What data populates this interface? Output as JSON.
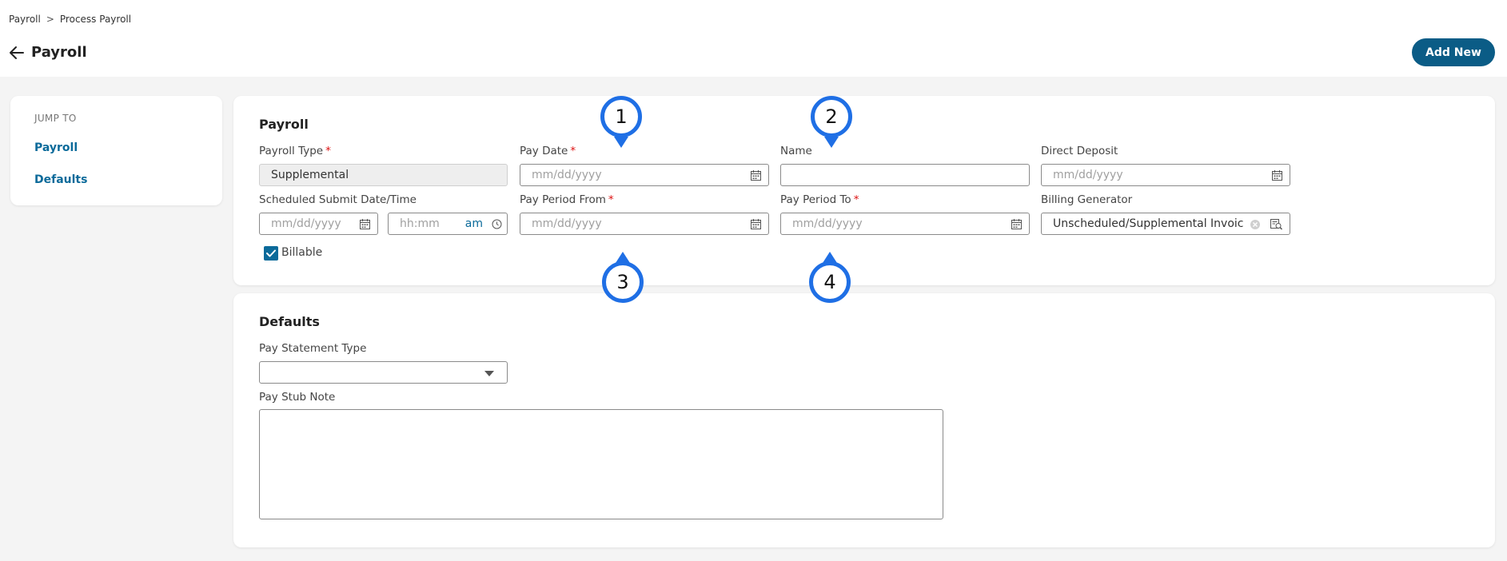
{
  "breadcrumb": {
    "root": "Payroll",
    "separator": ">",
    "current": "Process Payroll"
  },
  "header": {
    "title": "Payroll",
    "add_new_label": "Add New"
  },
  "jump_to": {
    "title": "JUMP TO",
    "links": [
      "Payroll",
      "Defaults"
    ]
  },
  "payroll_section": {
    "title": "Payroll",
    "payroll_type": {
      "label": "Payroll Type",
      "required_mark": "*",
      "value": "Supplemental"
    },
    "pay_date": {
      "label": "Pay Date",
      "required_mark": "*",
      "placeholder": "mm/dd/yyyy"
    },
    "name": {
      "label": "Name",
      "value": ""
    },
    "direct_deposit": {
      "label": "Direct Deposit",
      "placeholder": "mm/dd/yyyy"
    },
    "scheduled_submit": {
      "label": "Scheduled Submit Date/Time",
      "date_placeholder": "mm/dd/yyyy",
      "time_placeholder": "hh:mm",
      "ampm": "am"
    },
    "pay_period_from": {
      "label": "Pay Period From",
      "required_mark": "*",
      "placeholder": "mm/dd/yyyy"
    },
    "pay_period_to": {
      "label": "Pay Period To",
      "required_mark": "*",
      "placeholder": "mm/dd/yyyy"
    },
    "billing_generator": {
      "label": "Billing Generator",
      "value": "Unscheduled/Supplemental Invoice"
    },
    "billable": {
      "label": "Billable",
      "checked": true
    }
  },
  "defaults_section": {
    "title": "Defaults",
    "pay_statement_type": {
      "label": "Pay Statement Type",
      "value": ""
    },
    "pay_stub_note": {
      "label": "Pay Stub Note",
      "value": ""
    }
  },
  "annotations": {
    "marker_1": "1",
    "marker_2": "2",
    "marker_3": "3",
    "marker_4": "4"
  },
  "colors": {
    "primary_button": "#0b5c86",
    "link": "#0b6a9a",
    "required": "#dd1111",
    "annotation": "#1f6fe5"
  },
  "icons": [
    "back-arrow-icon",
    "calendar-icon",
    "clock-icon",
    "clear-icon",
    "lookup-icon",
    "chevron-down-icon",
    "check-icon"
  ]
}
